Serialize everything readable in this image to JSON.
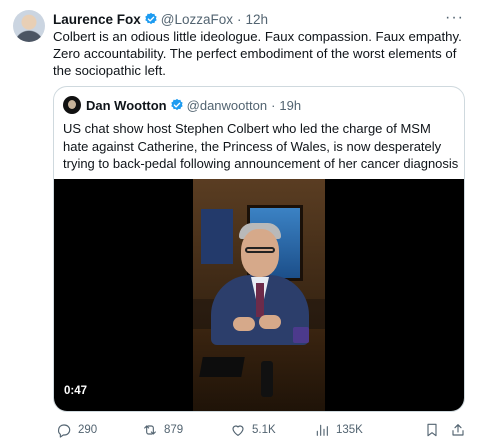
{
  "tweet": {
    "author_name": "Laurence Fox",
    "handle": "@LozzaFox",
    "separator": "·",
    "time": "12h",
    "more": "···",
    "text": "Colbert is an odious little ideologue. Faux compassion. Faux empathy. Zero accountability. The perfect embodiment of the worst elements of the sociopathic left."
  },
  "quote": {
    "author_name": "Dan Wootton",
    "handle": "@danwootton",
    "separator": "·",
    "time": "19h",
    "text": "US chat show host Stephen Colbert  who led the charge of MSM hate against Catherine, the Princess of Wales, is now desperately trying to back-pedal following announcement of her cancer diagnosis",
    "video": {
      "duration": "0:47"
    }
  },
  "actions": {
    "replies": "290",
    "reposts": "879",
    "likes": "5.1K",
    "views": "135K"
  },
  "colors": {
    "verified": "#1d9bf0",
    "muted": "#536471",
    "border": "#cfd9de"
  }
}
